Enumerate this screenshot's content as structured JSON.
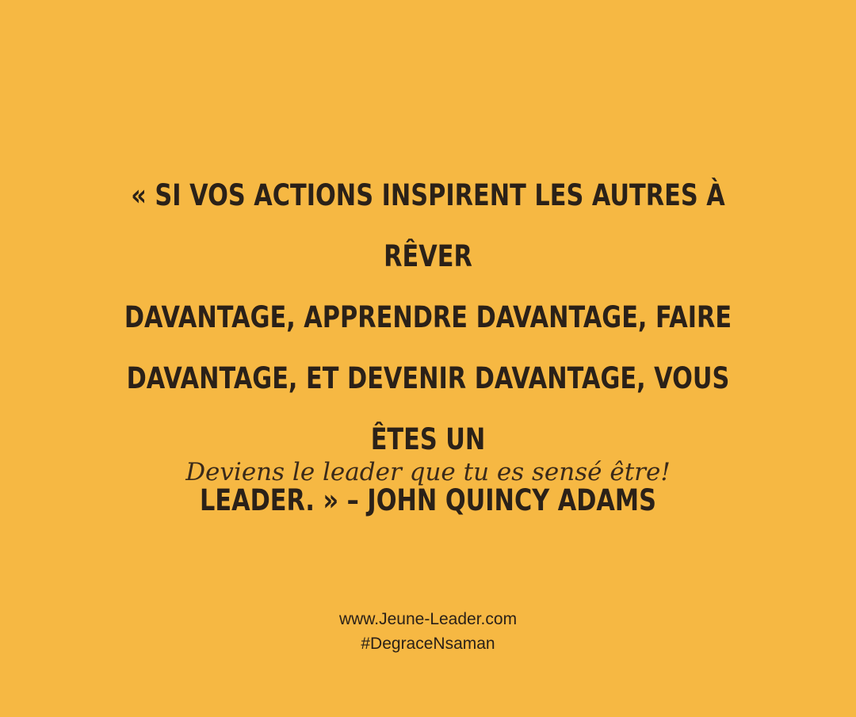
{
  "quote": {
    "lines": [
      "« SI VOS ACTIONS INSPIRENT LES AUTRES À RÊVER",
      "DAVANTAGE, APPRENDRE DAVANTAGE, FAIRE",
      "DAVANTAGE, ET DEVENIR DAVANTAGE, VOUS ÊTES UN",
      "LEADER. » – JOHN QUINCY ADAMS"
    ]
  },
  "tagline": "Deviens le leader que tu es sensé être!",
  "footer": {
    "website": "www.Jeune-Leader.com",
    "hashtag": "#DegraceNsaman"
  },
  "colors": {
    "background": "#f6b843",
    "text": "#2b2118"
  }
}
